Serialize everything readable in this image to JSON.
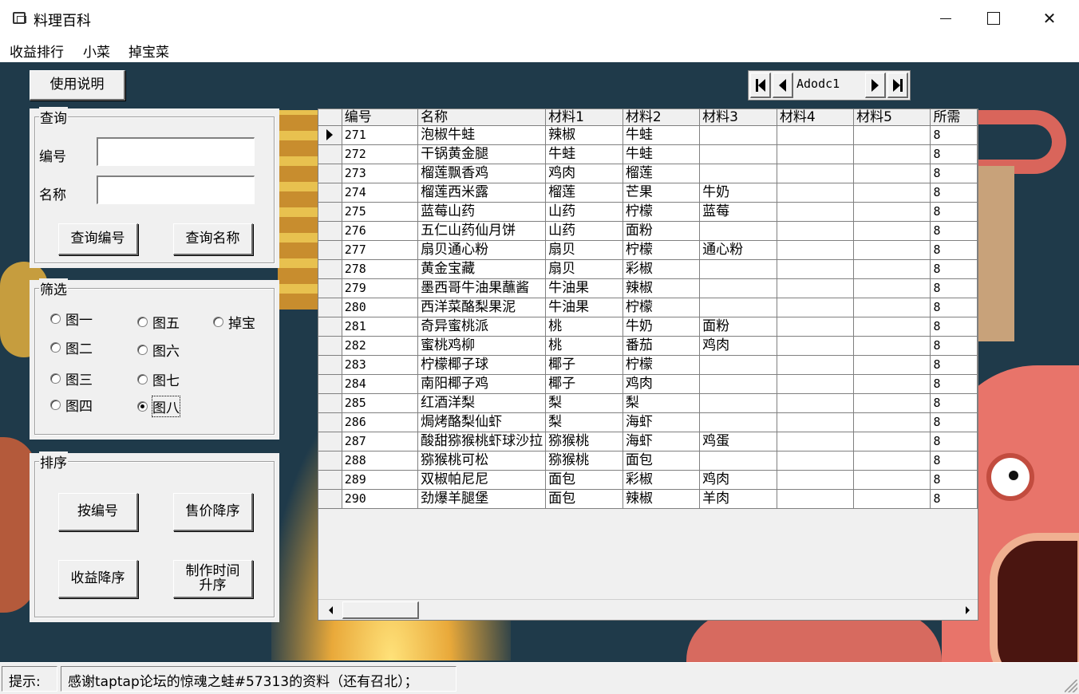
{
  "window": {
    "title": "料理百科"
  },
  "menu": [
    "收益排行",
    "小菜",
    "掉宝菜"
  ],
  "help_button": "使用说明",
  "query": {
    "legend": "查询",
    "id_label": "编号",
    "id_value": "",
    "name_label": "名称",
    "name_value": "",
    "query_id_button": "查询编号",
    "query_name_button": "查询名称"
  },
  "filter": {
    "legend": "筛选",
    "options": [
      {
        "label": "图一",
        "checked": false
      },
      {
        "label": "图二",
        "checked": false
      },
      {
        "label": "图三",
        "checked": false
      },
      {
        "label": "图四",
        "checked": false
      },
      {
        "label": "图五",
        "checked": false
      },
      {
        "label": "图六",
        "checked": false
      },
      {
        "label": "图七",
        "checked": false
      },
      {
        "label": "图八",
        "checked": true
      },
      {
        "label": "掉宝",
        "checked": false
      }
    ]
  },
  "sort": {
    "legend": "排序",
    "by_id": "按编号",
    "price_desc": "售价降序",
    "profit_desc": "收益降序",
    "time_asc": "制作时间\n升序"
  },
  "adodc": {
    "caption": "Adodc1"
  },
  "grid": {
    "columns": [
      "编号",
      "名称",
      "材料1",
      "材料2",
      "材料3",
      "材料4",
      "材料5",
      "所需"
    ],
    "rows": [
      [
        "271",
        "泡椒牛蛙",
        "辣椒",
        "牛蛙",
        "",
        "",
        "",
        "8"
      ],
      [
        "272",
        "干锅黄金腿",
        "牛蛙",
        "牛蛙",
        "",
        "",
        "",
        "8"
      ],
      [
        "273",
        "榴莲飘香鸡",
        "鸡肉",
        "榴莲",
        "",
        "",
        "",
        "8"
      ],
      [
        "274",
        "榴莲西米露",
        "榴莲",
        "芒果",
        "牛奶",
        "",
        "",
        "8"
      ],
      [
        "275",
        "蓝莓山药",
        "山药",
        "柠檬",
        "蓝莓",
        "",
        "",
        "8"
      ],
      [
        "276",
        "五仁山药仙月饼",
        "山药",
        "面粉",
        "",
        "",
        "",
        "8"
      ],
      [
        "277",
        "扇贝通心粉",
        "扇贝",
        "柠檬",
        "通心粉",
        "",
        "",
        "8"
      ],
      [
        "278",
        "黄金宝藏",
        "扇贝",
        "彩椒",
        "",
        "",
        "",
        "8"
      ],
      [
        "279",
        "墨西哥牛油果蘸酱",
        "牛油果",
        "辣椒",
        "",
        "",
        "",
        "8"
      ],
      [
        "280",
        "西洋菜酪梨果泥",
        "牛油果",
        "柠檬",
        "",
        "",
        "",
        "8"
      ],
      [
        "281",
        "奇异蜜桃派",
        "桃",
        "牛奶",
        "面粉",
        "",
        "",
        "8"
      ],
      [
        "282",
        "蜜桃鸡柳",
        "桃",
        "番茄",
        "鸡肉",
        "",
        "",
        "8"
      ],
      [
        "283",
        "柠檬椰子球",
        "椰子",
        "柠檬",
        "",
        "",
        "",
        "8"
      ],
      [
        "284",
        "南阳椰子鸡",
        "椰子",
        "鸡肉",
        "",
        "",
        "",
        "8"
      ],
      [
        "285",
        "红酒洋梨",
        "梨",
        "梨",
        "",
        "",
        "",
        "8"
      ],
      [
        "286",
        "焗烤酪梨仙虾",
        "梨",
        "海虾",
        "",
        "",
        "",
        "8"
      ],
      [
        "287",
        "酸甜猕猴桃虾球沙拉",
        "猕猴桃",
        "海虾",
        "鸡蛋",
        "",
        "",
        "8"
      ],
      [
        "288",
        "猕猴桃可松",
        "猕猴桃",
        "面包",
        "",
        "",
        "",
        "8"
      ],
      [
        "289",
        "双椒帕尼尼",
        "面包",
        "彩椒",
        "鸡肉",
        "",
        "",
        "8"
      ],
      [
        "290",
        "劲爆羊腿堡",
        "面包",
        "辣椒",
        "羊肉",
        "",
        "",
        "8"
      ]
    ]
  },
  "status": {
    "label": "提示:",
    "message": "感谢taptap论坛的惊魂之蛙#57313的资料（还有召北）；"
  }
}
